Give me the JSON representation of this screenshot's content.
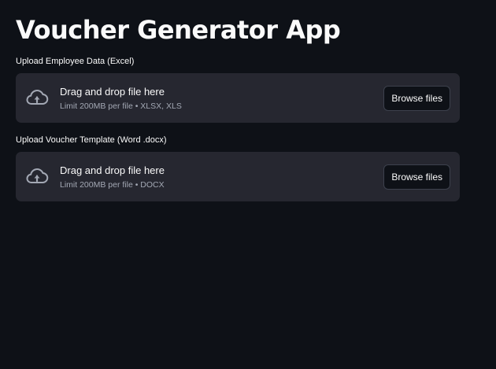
{
  "app": {
    "title": "Voucher Generator App"
  },
  "uploaders": [
    {
      "label": "Upload Employee Data (Excel)",
      "dropzone_title": "Drag and drop file here",
      "limit_text": "Limit 200MB per file • XLSX, XLS",
      "button_label": "Browse files",
      "icon": "cloud-upload-icon"
    },
    {
      "label": "Upload Voucher Template (Word .docx)",
      "dropzone_title": "Drag and drop file here",
      "limit_text": "Limit 200MB per file • DOCX",
      "button_label": "Browse files",
      "icon": "cloud-upload-icon"
    }
  ],
  "colors": {
    "background": "#0e1117",
    "dropzone": "#262730",
    "text": "#fafafa",
    "muted_text": "#a3a8b4",
    "icon": "#a3a8b4"
  }
}
